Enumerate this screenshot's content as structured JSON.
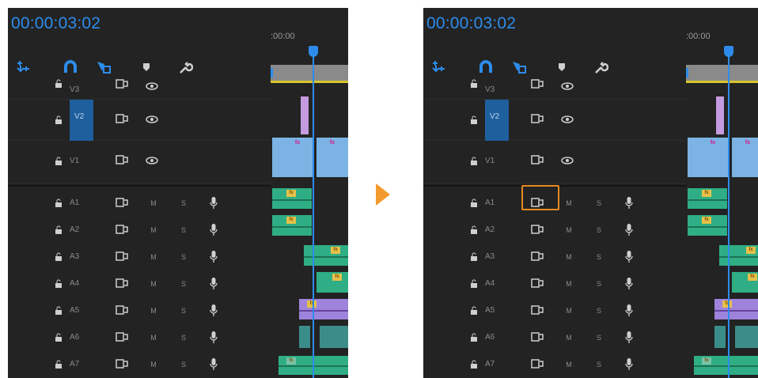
{
  "panels": [
    {
      "timecode": "00:00:03:02",
      "ruler_label": ":00:00",
      "tracks_video": [
        {
          "name": "V3"
        },
        {
          "name": "V2",
          "targeted": true
        },
        {
          "name": "V1"
        }
      ],
      "tracks_audio": [
        {
          "name": "A1",
          "mute": "M",
          "solo": "S"
        },
        {
          "name": "A2",
          "mute": "M",
          "solo": "S"
        },
        {
          "name": "A3",
          "mute": "M",
          "solo": "S"
        },
        {
          "name": "A4",
          "mute": "M",
          "solo": "S"
        },
        {
          "name": "A5",
          "mute": "M",
          "solo": "S"
        },
        {
          "name": "A6",
          "mute": "M",
          "solo": "S"
        },
        {
          "name": "A7",
          "mute": "M",
          "solo": "S"
        }
      ]
    },
    {
      "timecode": "00:00:03:02",
      "ruler_label": ":00:00",
      "tracks_video": [
        {
          "name": "V3"
        },
        {
          "name": "V2",
          "targeted": true
        },
        {
          "name": "V1"
        }
      ],
      "tracks_audio": [
        {
          "name": "A1",
          "mute": "M",
          "solo": "S",
          "highlighted": true
        },
        {
          "name": "A2",
          "mute": "M",
          "solo": "S"
        },
        {
          "name": "A3",
          "mute": "M",
          "solo": "S"
        },
        {
          "name": "A4",
          "mute": "M",
          "solo": "S"
        },
        {
          "name": "A5",
          "mute": "M",
          "solo": "S"
        },
        {
          "name": "A6",
          "mute": "M",
          "solo": "S"
        },
        {
          "name": "A7",
          "mute": "M",
          "solo": "S"
        }
      ]
    }
  ],
  "fx_label": "fx",
  "toolbar_icons": [
    "nest-sequence-icon",
    "snap-magnet-icon",
    "linked-selection-icon",
    "add-marker-icon",
    "wrench-settings-icon"
  ],
  "colors": {
    "timecode": "#2d8ceb",
    "highlight": "#e58a1f",
    "arrow": "#f29a2e",
    "target": "#1e5f9e"
  }
}
